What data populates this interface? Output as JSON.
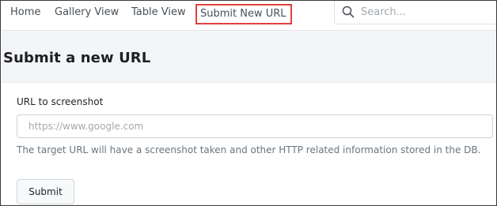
{
  "nav": {
    "home": "Home",
    "gallery": "Gallery View",
    "table": "Table View",
    "submit": "Submit New URL"
  },
  "search": {
    "placeholder": "Search...",
    "icon": "search-icon"
  },
  "page": {
    "title": "Submit a new URL"
  },
  "form": {
    "label": "URL to screenshot",
    "url_placeholder": "https://www.google.com",
    "url_value": "",
    "help": "The target URL will have a screenshot taken and other HTTP related information stored in the DB.",
    "submit_label": "Submit"
  },
  "colors": {
    "highlight": "#e0413a",
    "header_bg": "#f4f5f9",
    "muted_text": "#6c757d"
  }
}
